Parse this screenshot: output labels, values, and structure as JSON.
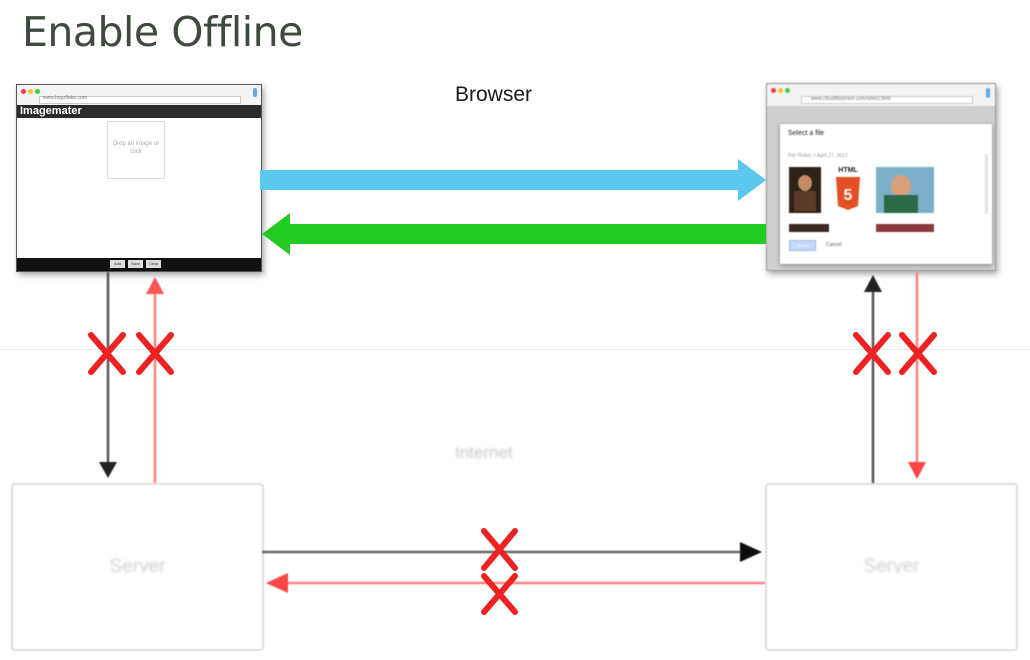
{
  "title": "Enable Offline",
  "diagram": {
    "browser_label": "Browser",
    "internet_label": "Internet",
    "servers": [
      {
        "label": "Server"
      },
      {
        "label": "Server"
      }
    ],
    "left_window": {
      "url": "www.buyzflake.com",
      "app_name": "Imagemater",
      "drop_zone_text": "Drop an image or click",
      "footer_buttons": [
        "Add",
        "Save",
        "Clear"
      ]
    },
    "right_window": {
      "url": "www.cloudfilepicker.com/select.html",
      "dialog_title": "Select a file",
      "breadcrumb": "File Picker > April 27, 2012",
      "thumb_html_label": "HTML",
      "select_button": "Select",
      "cancel_button": "Cancel"
    },
    "colors": {
      "blue_arrow": "#5bc8ee",
      "green_arrow": "#22cc22",
      "blocked_x": "#ee2222",
      "red_line": "#ff7777",
      "black_line": "#555555"
    }
  }
}
